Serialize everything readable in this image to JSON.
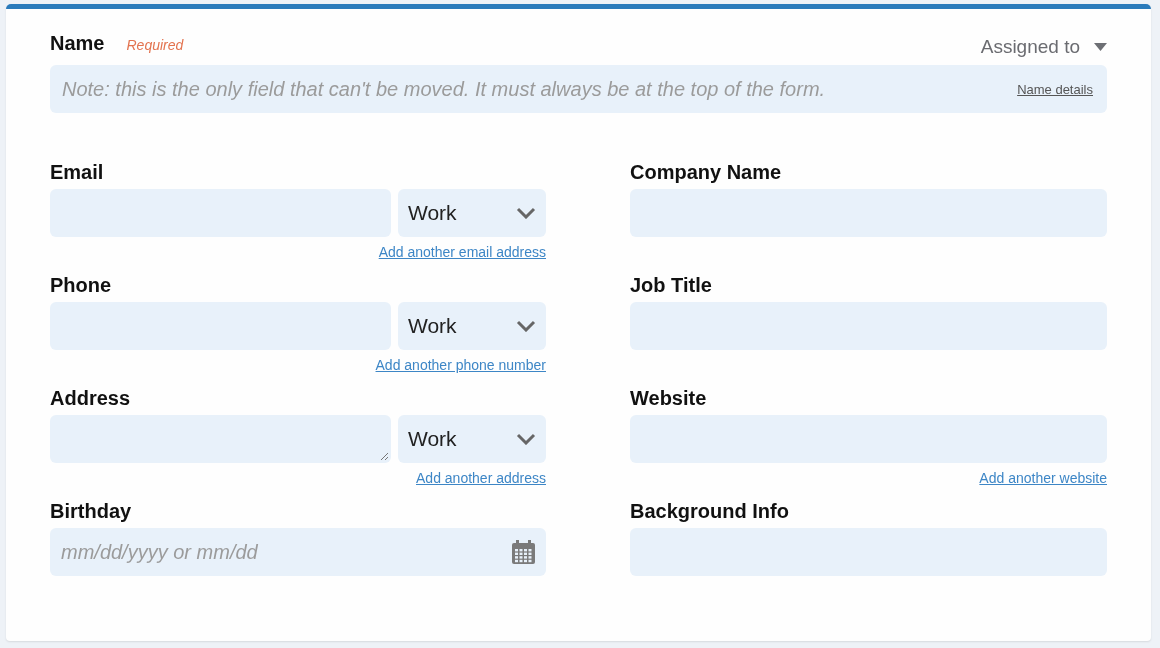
{
  "name_field": {
    "label": "Name",
    "required": "Required",
    "placeholder": "Note: this is the only field that can't be moved. It must always be at the top of the form.",
    "link": "Name details"
  },
  "assigned_to": {
    "label": "Assigned to"
  },
  "columns": [
    [
      {
        "kind": "text",
        "label": "Email",
        "select": "Work",
        "link": "Add another email address"
      },
      {
        "kind": "text",
        "label": "Phone",
        "select": "Work",
        "link": "Add another phone number"
      },
      {
        "kind": "textarea",
        "label": "Address",
        "select": "Work",
        "link": "Add another address"
      },
      {
        "kind": "date",
        "label": "Birthday",
        "placeholder": "mm/dd/yyyy or mm/dd"
      }
    ],
    [
      {
        "kind": "text",
        "label": "Company Name"
      },
      {
        "kind": "text",
        "label": "Job Title"
      },
      {
        "kind": "text",
        "label": "Website",
        "link": "Add another website"
      },
      {
        "kind": "text",
        "label": "Background Info"
      }
    ]
  ]
}
